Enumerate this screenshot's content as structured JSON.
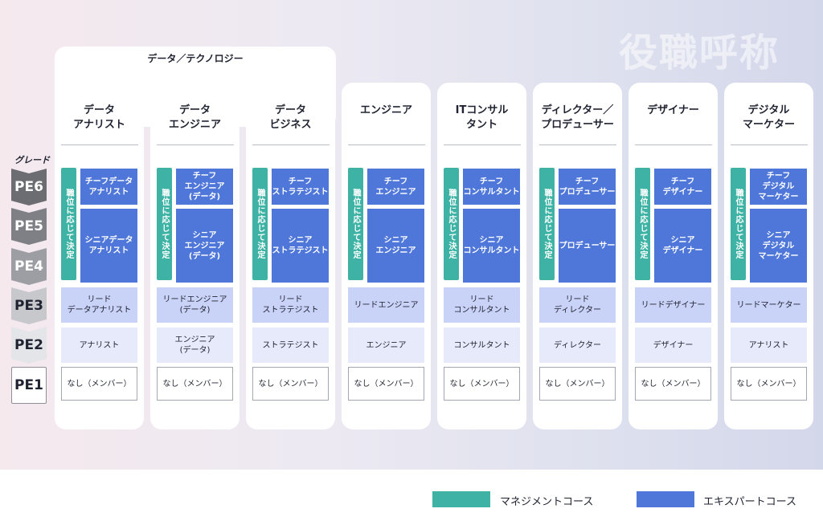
{
  "page_title": "役職呼称",
  "group_label": "データ／テクノロジー",
  "grade_label": "グレード",
  "grades": [
    {
      "label": "PE6",
      "bg": "#6b6d72",
      "fg": "#ffffff"
    },
    {
      "label": "PE5",
      "bg": "#7e8086",
      "fg": "#ffffff"
    },
    {
      "label": "PE4",
      "bg": "#9c9ea3",
      "fg": "#ffffff"
    },
    {
      "label": "PE3",
      "bg": "#c7c8cc",
      "fg": "#1f2230"
    },
    {
      "label": "PE2",
      "bg": "#e4e5e8",
      "fg": "#1f2230"
    },
    {
      "label": "PE1",
      "bg": "#ffffff",
      "fg": "#1f2230"
    }
  ],
  "management_cell": "職位に応じて決定",
  "columns": [
    {
      "title": "データ\nアナリスト",
      "chief": "チーフデータ\nアナリスト",
      "senior": "シニアデータ\nアナリスト",
      "lead": "リード\nデータアナリスト",
      "pe2": "アナリスト",
      "member": "なし（メンバー）"
    },
    {
      "title": "データ\nエンジニア",
      "chief": "チーフ\nエンジニア\n(データ)",
      "senior": "シニア\nエンジニア\n(データ)",
      "lead": "リードエンジニア\n(データ)",
      "pe2": "エンジニア\n(データ)",
      "member": "なし（メンバー）"
    },
    {
      "title": "データ\nビジネス",
      "chief": "チーフ\nストラテジスト",
      "senior": "シニア\nストラテジスト",
      "lead": "リード\nストラテジスト",
      "pe2": "ストラテジスト",
      "member": "なし（メンバー）"
    },
    {
      "title": "エンジニア",
      "chief": "チーフ\nエンジニア",
      "senior": "シニア\nエンジニア",
      "lead": "リードエンジニア",
      "pe2": "エンジニア",
      "member": "なし（メンバー）"
    },
    {
      "title": "ITコンサル\nタント",
      "chief": "チーフ\nコンサルタント",
      "senior": "シニア\nコンサルタント",
      "lead": "リード\nコンサルタント",
      "pe2": "コンサルタント",
      "member": "なし（メンバー）"
    },
    {
      "title": "ディレクター／\nプロデューサー",
      "chief": "チーフ\nプロデューサー",
      "senior": "プロデューサー",
      "lead": "リード\nディレクター",
      "pe2": "ディレクター",
      "member": "なし（メンバー）"
    },
    {
      "title": "デザイナー",
      "chief": "チーフ\nデザイナー",
      "senior": "シニア\nデザイナー",
      "lead": "リードデザイナー",
      "pe2": "デザイナー",
      "member": "なし（メンバー）"
    },
    {
      "title": "デジタル\nマーケター",
      "chief": "チーフ\nデジタル\nマーケター",
      "senior": "シニア\nデジタル\nマーケター",
      "lead": "リードマーケター",
      "pe2": "アナリスト",
      "member": "なし（メンバー）"
    }
  ],
  "legend": [
    {
      "label": "マネジメントコース",
      "color": "#3eb3a5"
    },
    {
      "label": "エキスパートコース",
      "color": "#4e77d9"
    }
  ]
}
